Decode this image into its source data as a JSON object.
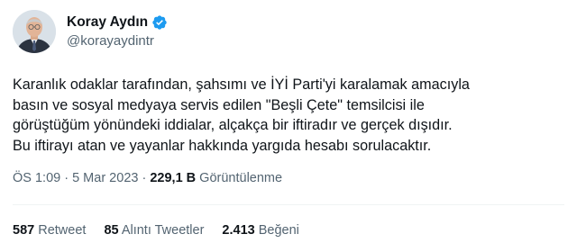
{
  "author": {
    "display_name": "Koray Aydın",
    "handle": "@korayaydintr",
    "verified": true,
    "verified_color": "#1d9bf0"
  },
  "tweet": {
    "lines": [
      "Karanlık odaklar tarafından, şahsımı ve İYİ Parti'yi karalamak amacıyla",
      "basın ve sosyal medyaya servis edilen \"Beşli Çete\" temsilcisi ile",
      "görüştüğüm yönündeki iddialar, alçakça bir iftiradır ve gerçek dışıdır.",
      "Bu iftirayı atan ve yayanlar hakkında yargıda hesabı sorulacaktır."
    ]
  },
  "meta": {
    "time": "ÖS 1:09",
    "date": "5 Mar 2023",
    "views_count": "229,1 B",
    "views_label": "Görüntülenme"
  },
  "stats": {
    "retweets_count": "587",
    "retweets_label": "Retweet",
    "quotes_count": "85",
    "quotes_label": "Alıntı Tweetler",
    "likes_count": "2.413",
    "likes_label": "Beğeni"
  },
  "colors": {
    "text": "#0f1419",
    "secondary": "#536471",
    "divider": "#eff3f4"
  }
}
